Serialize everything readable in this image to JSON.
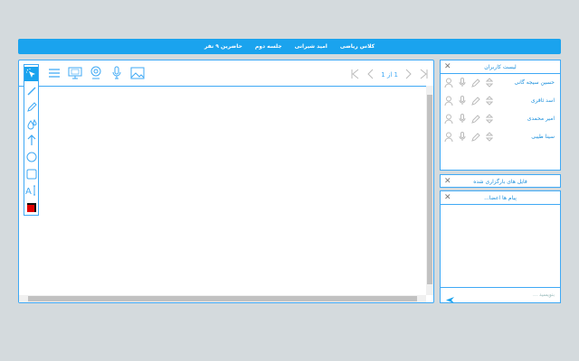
{
  "topbar": {
    "class_title": "کلاس ریاضی",
    "teacher": "امید شیرانی",
    "session": "جلسه دوم",
    "attendance": "حاضرین ۹ نفر"
  },
  "board": {
    "pager": {
      "text": "1 از 1"
    },
    "tool_color": "#e10000"
  },
  "users_panel": {
    "title": "لیست کاربران",
    "users": [
      {
        "name": "حسین سیجه گانی"
      },
      {
        "name": "اسد ثاقری"
      },
      {
        "name": "امیر محمدی"
      },
      {
        "name": "سینا طیبی"
      }
    ]
  },
  "files_panel": {
    "title": "فایل های بارگزاری شده"
  },
  "chat_panel": {
    "title": "پیام ها اعضا...",
    "input_placeholder": "بنویسید ..."
  }
}
